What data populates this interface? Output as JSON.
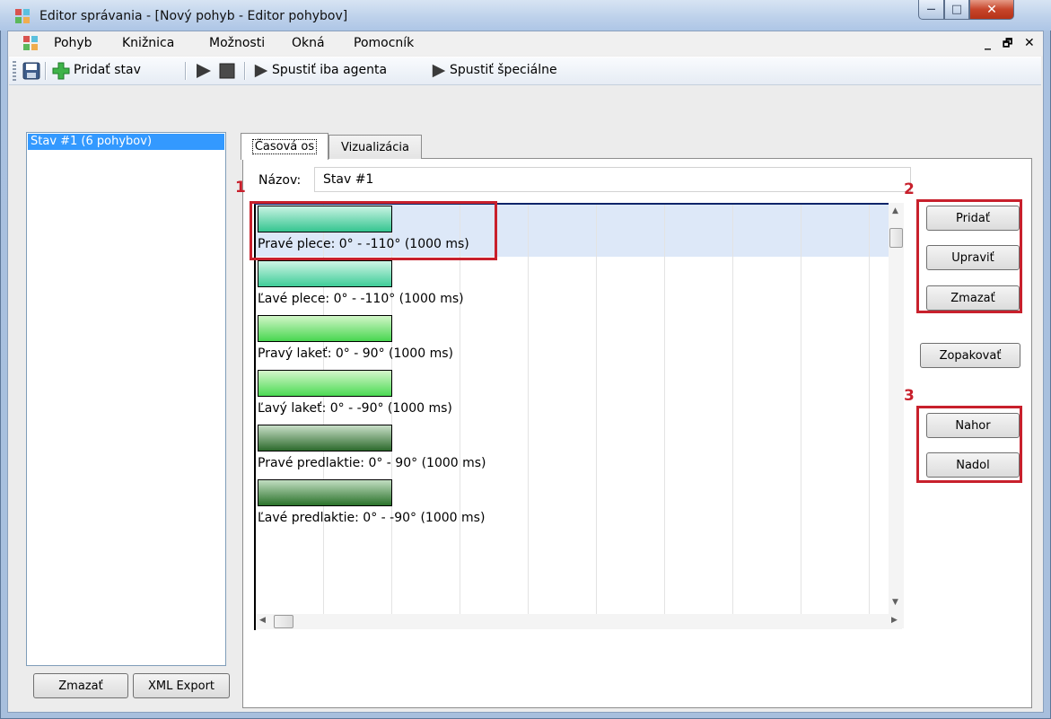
{
  "window": {
    "title": "Editor správania - [Nový pohyb - Editor pohybov]",
    "controls": {
      "minimize": "—",
      "maximize": "□",
      "close": "✕"
    }
  },
  "menu": {
    "items": [
      "Pohyb",
      "Knižnica",
      "Možnosti",
      "Okná",
      "Pomocník"
    ],
    "mdi_min": "_",
    "mdi_restore": "🗗",
    "mdi_close": "✕"
  },
  "toolbar": {
    "add_state": "Pridať stav",
    "run_agent": "Spustiť iba agenta",
    "run_special": "Spustiť špeciálne"
  },
  "states": {
    "items": [
      "Stav #1 (6 pohybov)"
    ],
    "delete_button": "Zmazať",
    "export_button": "XML Export"
  },
  "tabs": [
    "Časová os",
    "Vizualizácia"
  ],
  "editor": {
    "name_label": "Názov:",
    "name_value": "Stav #1"
  },
  "movements": [
    {
      "label": "Pravé plece: 0° - -110° (1000 ms)",
      "color_top": "#c9f3e3",
      "color_bottom": "#35c590"
    },
    {
      "label": "Ľavé plece: 0° - -110° (1000 ms)",
      "color_top": "#cff5e6",
      "color_bottom": "#3fcd98"
    },
    {
      "label": "Pravý lakeť: 0° - 90° (1000 ms)",
      "color_top": "#d2f6c8",
      "color_bottom": "#48d650"
    },
    {
      "label": "Ľavý lakeť: 0° - -90° (1000 ms)",
      "color_top": "#d5f7cb",
      "color_bottom": "#4cda54"
    },
    {
      "label": "Pravé predlaktie: 0° - 90° (1000 ms)",
      "color_top": "#c9dfc8",
      "color_bottom": "#2c6a2c"
    },
    {
      "label": "Ľavé predlaktie: 0° - -90° (1000 ms)",
      "color_top": "#c2dec2",
      "color_bottom": "#2a722a"
    }
  ],
  "actions": {
    "add": "Pridať",
    "edit": "Upraviť",
    "delete": "Zmazať",
    "repeat": "Zopakovať",
    "up": "Nahor",
    "down": "Nadol"
  },
  "annotations": [
    "1",
    "2",
    "3"
  ],
  "colors": {
    "selection": "#3399ff",
    "annotation": "#c8202c"
  }
}
